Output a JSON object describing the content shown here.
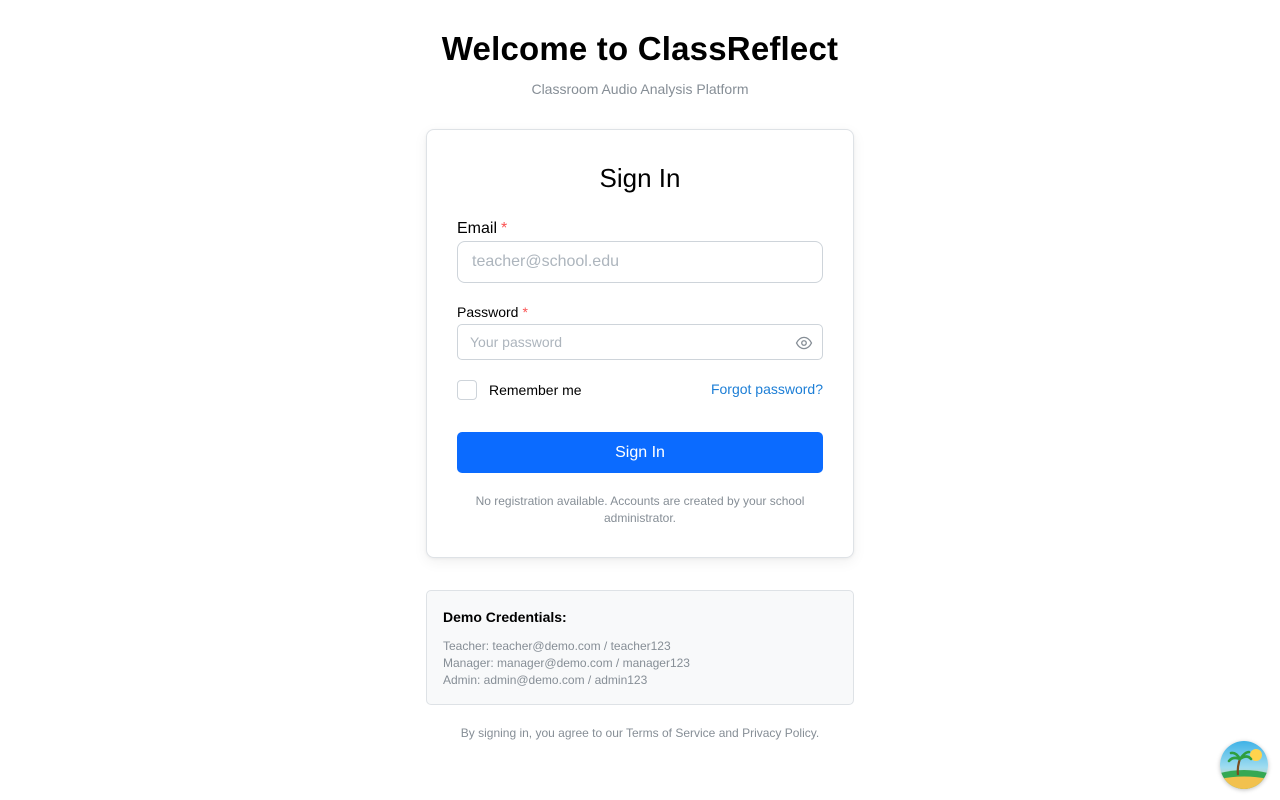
{
  "header": {
    "title": "Welcome to ClassReflect",
    "subtitle": "Classroom Audio Analysis Platform"
  },
  "form": {
    "title": "Sign In",
    "email": {
      "label": "Email",
      "required_mark": "*",
      "placeholder": "teacher@school.edu",
      "value": ""
    },
    "password": {
      "label": "Password",
      "required_mark": "*",
      "placeholder": "Your password",
      "value": "",
      "toggle_icon": "eye-icon"
    },
    "remember": {
      "label": "Remember me",
      "checked": false
    },
    "forgot_label": "Forgot password?",
    "submit_label": "Sign In",
    "note": "No registration available. Accounts are created by your school administrator."
  },
  "demo": {
    "title": "Demo Credentials:",
    "lines": [
      "Teacher: teacher@demo.com / teacher123",
      "Manager: manager@demo.com / manager123",
      "Admin: admin@demo.com / admin123"
    ]
  },
  "legal": {
    "prefix": "By signing in, you agree to our",
    "terms": "Terms of Service",
    "and": "and",
    "privacy": "Privacy Policy",
    "suffix": "."
  },
  "colors": {
    "primary": "#0b6bff",
    "link": "#1c7ed6",
    "required": "#fa5252",
    "muted_text": "#868e96"
  },
  "avatar": {
    "icon": "tropical-island-avatar"
  }
}
